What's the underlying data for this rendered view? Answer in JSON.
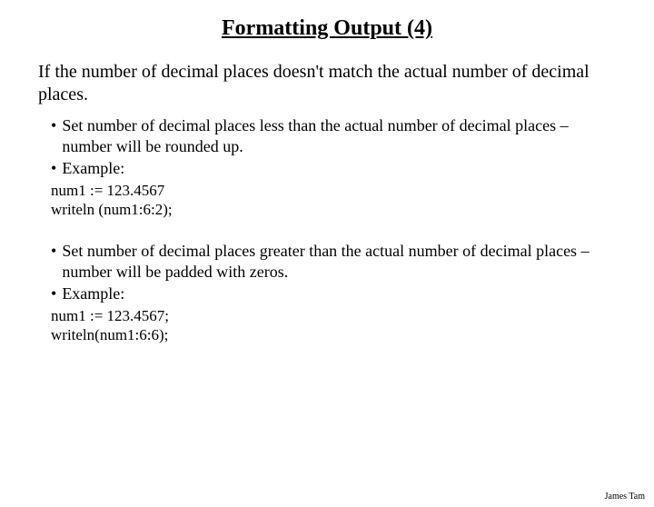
{
  "title": "Formatting Output (4)",
  "intro": "If the number of decimal places doesn't match the actual number of decimal places.",
  "section1": {
    "bullet1": "Set number of decimal places less than the actual number of decimal places – number will be rounded up.",
    "bullet2": "Example:",
    "code1": "num1 := 123.4567",
    "code2": "writeln (num1:6:2);"
  },
  "section2": {
    "bullet1": "Set number of decimal places greater than the actual number of decimal places – number will be padded with zeros.",
    "bullet2": "Example:",
    "code1": "num1 := 123.4567;",
    "code2": "writeln(num1:6:6);"
  },
  "author": "James Tam"
}
